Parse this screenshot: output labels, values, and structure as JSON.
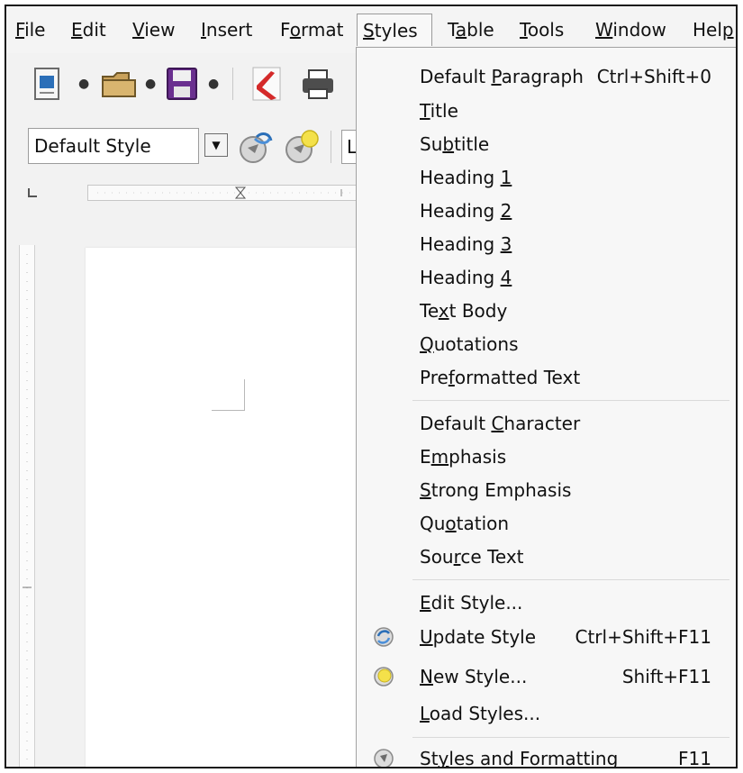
{
  "menubar": {
    "items": [
      {
        "pre": "",
        "ul": "F",
        "post": "ile"
      },
      {
        "pre": "",
        "ul": "E",
        "post": "dit"
      },
      {
        "pre": "",
        "ul": "V",
        "post": "iew"
      },
      {
        "pre": "",
        "ul": "I",
        "post": "nsert"
      },
      {
        "pre": "F",
        "ul": "o",
        "post": "rmat"
      },
      {
        "pre": "",
        "ul": "S",
        "post": "tyles"
      },
      {
        "pre": "T",
        "ul": "a",
        "post": "ble"
      },
      {
        "pre": "",
        "ul": "T",
        "post": "ools"
      },
      {
        "pre": "",
        "ul": "W",
        "post": "indow"
      },
      {
        "pre": "Hel",
        "ul": "p",
        "post": ""
      }
    ]
  },
  "toolbar2": {
    "paragraph_style": "Default Style",
    "font_name_partial": "Li"
  },
  "styles_menu": {
    "items": [
      {
        "pre": "Default ",
        "ul": "P",
        "post": "aragraph",
        "shortcut": "Ctrl+Shift+0"
      },
      {
        "pre": "",
        "ul": "T",
        "post": "itle",
        "shortcut": ""
      },
      {
        "pre": "Su",
        "ul": "b",
        "post": "title",
        "shortcut": ""
      },
      {
        "pre": "Heading ",
        "ul": "1",
        "post": "",
        "shortcut": ""
      },
      {
        "pre": "Heading ",
        "ul": "2",
        "post": "",
        "shortcut": ""
      },
      {
        "pre": "Heading ",
        "ul": "3",
        "post": "",
        "shortcut": ""
      },
      {
        "pre": "Heading ",
        "ul": "4",
        "post": "",
        "shortcut": ""
      },
      {
        "pre": "Te",
        "ul": "x",
        "post": "t Body",
        "shortcut": ""
      },
      {
        "pre": "",
        "ul": "Q",
        "post": "uotations",
        "shortcut": ""
      },
      {
        "pre": "Pre",
        "ul": "f",
        "post": "ormatted Text",
        "shortcut": ""
      },
      {
        "pre": "Default ",
        "ul": "C",
        "post": "haracter",
        "shortcut": ""
      },
      {
        "pre": "E",
        "ul": "m",
        "post": "phasis",
        "shortcut": ""
      },
      {
        "pre": "",
        "ul": "S",
        "post": "trong Emphasis",
        "shortcut": ""
      },
      {
        "pre": "Qu",
        "ul": "o",
        "post": "tation",
        "shortcut": ""
      },
      {
        "pre": "Sou",
        "ul": "r",
        "post": "ce Text",
        "shortcut": ""
      },
      {
        "pre": "",
        "ul": "E",
        "post": "dit Style...",
        "shortcut": ""
      },
      {
        "pre": "",
        "ul": "U",
        "post": "pdate Style",
        "shortcut": "Ctrl+Shift+F11",
        "icon": "update-style-icon"
      },
      {
        "pre": "",
        "ul": "N",
        "post": "ew Style...",
        "shortcut": "Shift+F11",
        "icon": "new-style-icon"
      },
      {
        "pre": "",
        "ul": "L",
        "post": "oad Styles...",
        "shortcut": ""
      },
      {
        "pre": "St",
        "ul": "y",
        "post": "les and Formatting",
        "shortcut": "F11",
        "icon": "styles-formatting-icon"
      }
    ]
  },
  "colors": {
    "pdf_red": "#d42a2a",
    "floppy_purple": "#6a2f8f",
    "folder_tan": "#c9a15a",
    "doc_blue": "#2b6fb8"
  }
}
